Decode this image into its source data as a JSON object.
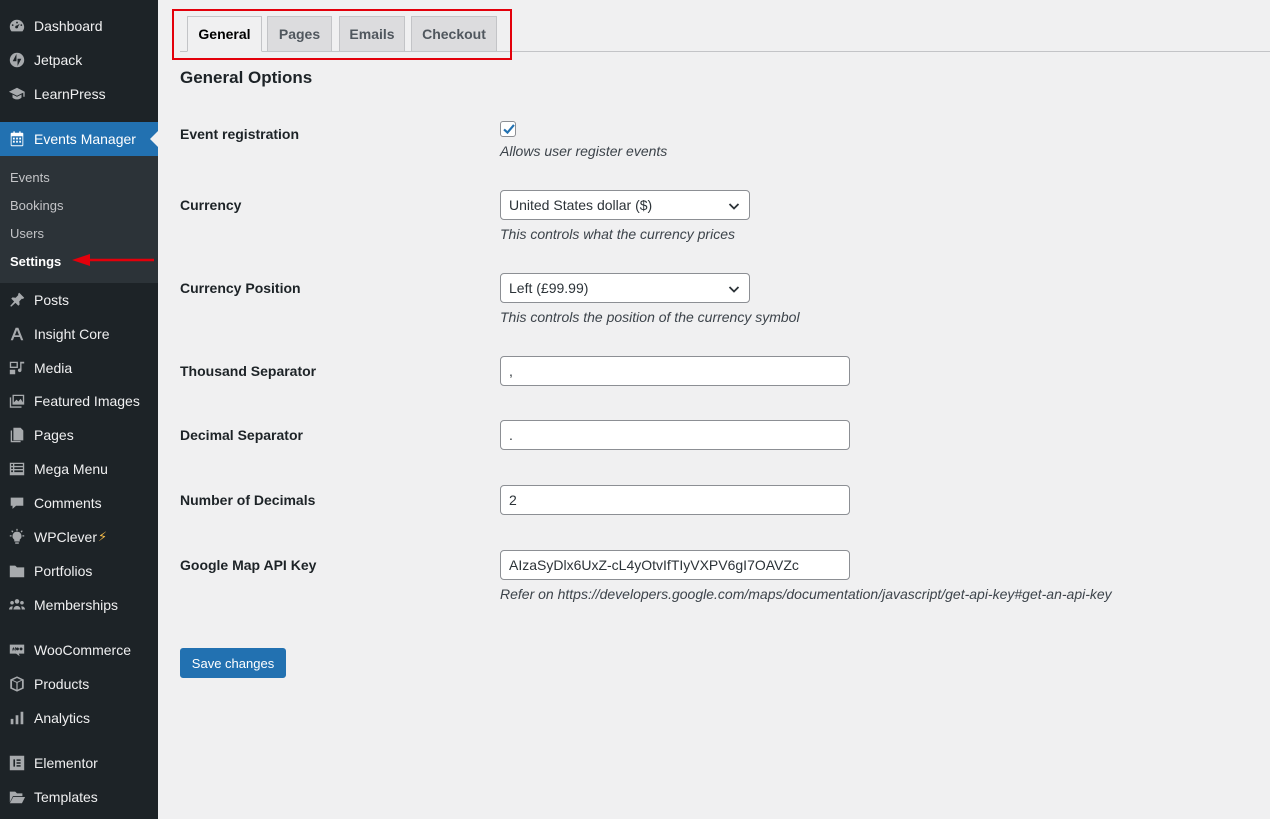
{
  "sidebar": {
    "items": [
      {
        "label": "Dashboard",
        "icon": "dashboard-icon"
      },
      {
        "label": "Jetpack",
        "icon": "jetpack-icon"
      },
      {
        "label": "LearnPress",
        "icon": "mortarboard-icon"
      },
      {
        "label": "Events Manager",
        "icon": "calendar-icon"
      },
      {
        "label": "Posts",
        "icon": "pin-icon"
      },
      {
        "label": "Insight Core",
        "icon": "insight-core-icon"
      },
      {
        "label": "Media",
        "icon": "media-icon"
      },
      {
        "label": "Featured Images",
        "icon": "images-icon"
      },
      {
        "label": "Pages",
        "icon": "pages-icon"
      },
      {
        "label": "Mega Menu",
        "icon": "list-icon"
      },
      {
        "label": "Comments",
        "icon": "comment-icon"
      },
      {
        "label": "WPClever",
        "icon": "lightbulb-icon",
        "suffix": "⚡"
      },
      {
        "label": "Portfolios",
        "icon": "folder-icon"
      },
      {
        "label": "Memberships",
        "icon": "groups-icon"
      },
      {
        "label": "WooCommerce",
        "icon": "woo-icon"
      },
      {
        "label": "Products",
        "icon": "box-icon"
      },
      {
        "label": "Analytics",
        "icon": "bar-chart-icon"
      },
      {
        "label": "Elementor",
        "icon": "elementor-icon"
      },
      {
        "label": "Templates",
        "icon": "folder-open-icon"
      }
    ],
    "submenu": [
      "Events",
      "Bookings",
      "Users",
      "Settings"
    ]
  },
  "tabs": [
    "General",
    "Pages",
    "Emails",
    "Checkout"
  ],
  "section_title": "General Options",
  "fields": {
    "event_registration": {
      "label": "Event registration",
      "desc": "Allows user register events",
      "checked": true
    },
    "currency": {
      "label": "Currency",
      "value": "United States dollar ($)",
      "desc": "This controls what the currency prices"
    },
    "currency_position": {
      "label": "Currency Position",
      "value": "Left (£99.99)",
      "desc": "This controls the position of the currency symbol"
    },
    "thousand_separator": {
      "label": "Thousand Separator",
      "value": ","
    },
    "decimal_separator": {
      "label": "Decimal Separator",
      "value": "."
    },
    "number_of_decimals": {
      "label": "Number of Decimals",
      "value": "2"
    },
    "google_map_api_key": {
      "label": "Google Map API Key",
      "value": "AIzaSyDlx6UxZ-cL4yOtvIfTIyVXPV6gI7OAVZc",
      "desc": "Refer on https://developers.google.com/maps/documentation/javascript/get-api-key#get-an-api-key"
    }
  },
  "save_label": "Save changes",
  "colors": {
    "accent": "#2271b1",
    "sidebar": "#1d2327",
    "annotation": "#e3000b"
  }
}
